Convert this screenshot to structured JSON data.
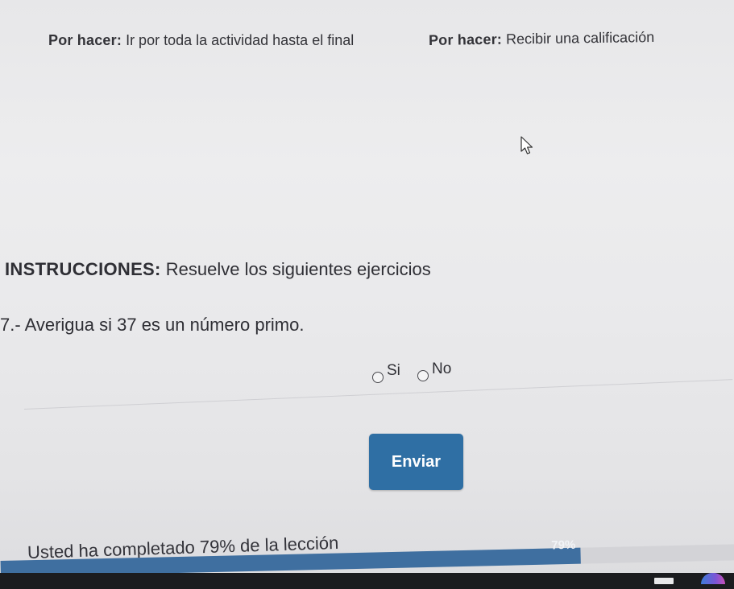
{
  "todo": {
    "left_prefix": "Por hacer:",
    "left_text": "Ir por toda la actividad hasta el final",
    "right_prefix": "Por hacer:",
    "right_text": "Recibir una calificación"
  },
  "instructions": {
    "label": "INSTRUCCIONES:",
    "text": "Resuelve los siguientes ejercicios"
  },
  "question": {
    "text": "7.- Averigua si 37 es un número primo.",
    "options": [
      "Si",
      "No"
    ],
    "selected": null
  },
  "submit": {
    "label": "Enviar",
    "color": "#2f6fa4"
  },
  "progress": {
    "text": "Usted ha completado 79% de la lección",
    "percent": 79,
    "label": "79%",
    "fill_color": "#3f6fa0"
  },
  "icons": {
    "cursor": "mouse-cursor-icon",
    "taskbar_app_1": "app-icon",
    "taskbar_app_2": "browser-icon"
  }
}
